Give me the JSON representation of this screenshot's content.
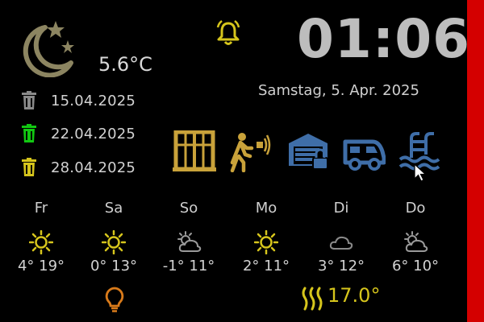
{
  "colors": {
    "background": "#000000",
    "accent_red": "#d40000",
    "gold": "#c9a23a",
    "yellow": "#d6c51c",
    "blue": "#3f6ea8",
    "grey_text": "#d2d2d2",
    "green": "#12c812",
    "orange": "#d87a1a"
  },
  "current": {
    "icon": "moon-stars-icon",
    "temperature": "5.6°C"
  },
  "trash": [
    {
      "icon": "trash-grey-icon",
      "date": "15.04.2025"
    },
    {
      "icon": "trash-green-icon",
      "date": "22.04.2025"
    },
    {
      "icon": "trash-yellow-icon",
      "date": "28.04.2025"
    }
  ],
  "clock": {
    "time": "01:06",
    "date": "Samstag, 5. Apr. 2025"
  },
  "alarm": {
    "icon": "bell-icon"
  },
  "devices": [
    {
      "name": "window-icon",
      "color": "#c9a23a"
    },
    {
      "name": "motion-sensor-icon",
      "color": "#c9a23a"
    },
    {
      "name": "garage-lock-icon",
      "color": "#3f6ea8"
    },
    {
      "name": "camper-icon",
      "color": "#3f6ea8"
    },
    {
      "name": "pool-icon",
      "color": "#3f6ea8"
    }
  ],
  "forecast": [
    {
      "day": "Fr",
      "icon": "sun-icon",
      "temps": "4° 19°"
    },
    {
      "day": "Sa",
      "icon": "sun-icon",
      "temps": "0° 13°"
    },
    {
      "day": "So",
      "icon": "partly-cloudy-icon",
      "temps": "-1° 11°"
    },
    {
      "day": "Mo",
      "icon": "sun-icon",
      "temps": "2° 11°"
    },
    {
      "day": "Di",
      "icon": "cloud-icon",
      "temps": "3° 12°"
    },
    {
      "day": "Do",
      "icon": "partly-cloudy-icon",
      "temps": "6° 10°"
    }
  ],
  "footer": {
    "light_icon": "lightbulb-icon",
    "heating_icon": "heating-icon",
    "heating_temp": "17.0°"
  }
}
